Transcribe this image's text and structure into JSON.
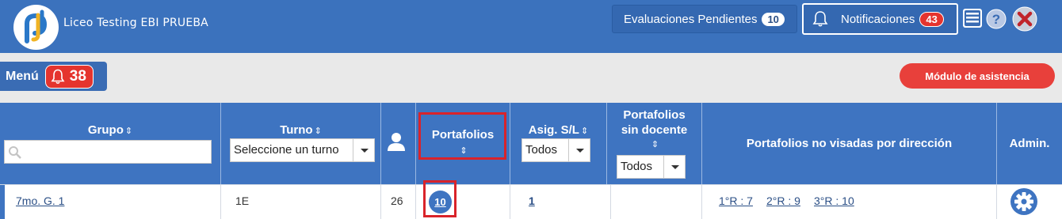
{
  "header": {
    "app_title": "Liceo Testing EBI PRUEBA",
    "evaluations_label": "Evaluaciones Pendientes",
    "evaluations_count": "10",
    "notifications_label": "Notificaciones",
    "notifications_count": "43"
  },
  "subbar": {
    "menu_label": "Menú",
    "menu_count": "38",
    "attendance_button": "Módulo de asistencia"
  },
  "table": {
    "columns": {
      "grupo": "Grupo",
      "turno": "Turno",
      "portafolios": "Portafolios",
      "asig": "Asig. S/L",
      "sin_docente_1": "Portafolios",
      "sin_docente_2": "sin docente",
      "no_visadas": "Portafolios no visadas por dirección",
      "admin": "Admin."
    },
    "filters": {
      "turno_select": "Seleccione un turno",
      "asig_select": "Todos",
      "sin_docente_select": "Todos"
    },
    "rows": [
      {
        "grupo": "7mo. G. 1",
        "turno": "1E",
        "alumnos": "26",
        "portafolios": "10",
        "asig": "1",
        "no_visadas_1": "1°R : 7",
        "no_visadas_2": "2°R : 9",
        "no_visadas_3": "3°R : 10"
      }
    ]
  },
  "colors": {
    "header_bg": "#3b72bd",
    "table_header_bg": "#3e74c1",
    "alert_red": "#e5342e",
    "highlight_red": "#d9232a"
  },
  "icons": [
    "logo-icon",
    "bell-icon",
    "list-icon",
    "help-icon",
    "close-icon",
    "search-icon",
    "sort-icon",
    "user-icon",
    "gear-icon"
  ]
}
